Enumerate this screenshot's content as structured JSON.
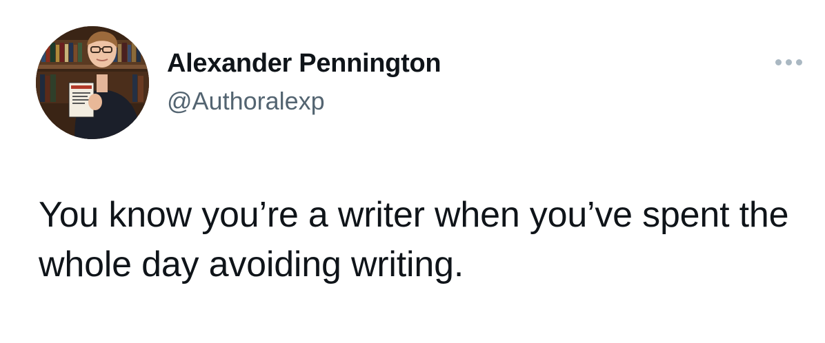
{
  "tweet": {
    "author": {
      "display_name": "Alexander Pennington",
      "handle": "@Authoralexp",
      "avatar_icon": "profile-photo-icon"
    },
    "more_icon": "more-options-icon",
    "text": "You know you’re a writer when you’ve spent the whole day avoiding writing."
  },
  "colors": {
    "text_primary": "#0f1419",
    "text_secondary": "#536471",
    "more_icon": "#aab8c2",
    "background": "#ffffff"
  }
}
